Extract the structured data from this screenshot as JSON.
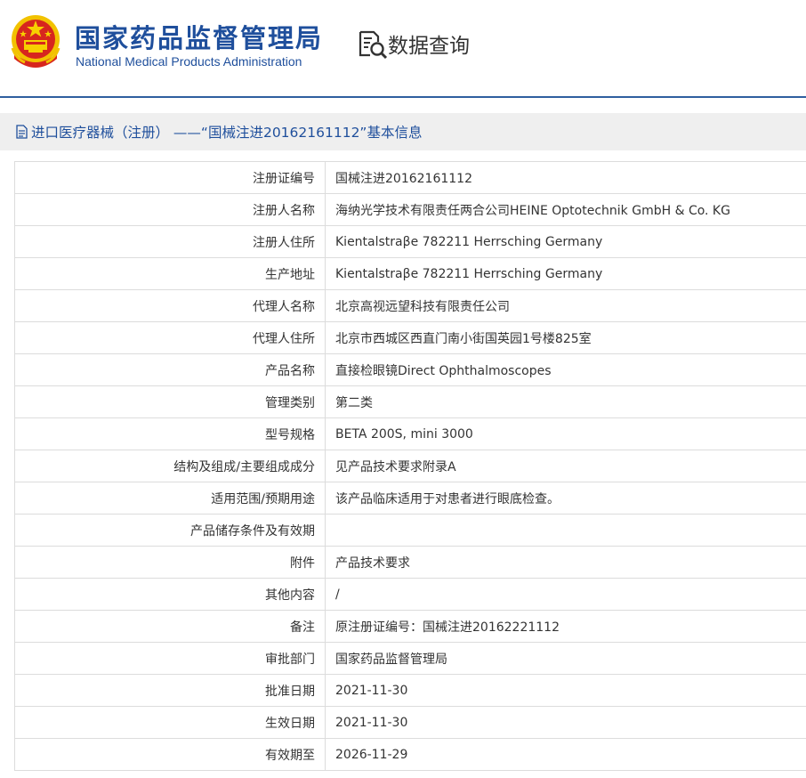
{
  "header": {
    "org_name_cn": "国家药品监督管理局",
    "org_name_en": "National Medical Products Administration",
    "query_label": "数据查询",
    "brand_color": "#1f4f9c"
  },
  "page_title": "进口医疗器械（注册） ——“国械注进20162161112”基本信息",
  "rows": [
    {
      "label": "注册证编号",
      "value": "国械注进20162161112"
    },
    {
      "label": "注册人名称",
      "value": "海纳光学技术有限责任两合公司HEINE Optotechnik GmbH & Co. KG"
    },
    {
      "label": "注册人住所",
      "value": "Kientalstraβe 782211 Herrsching Germany"
    },
    {
      "label": "生产地址",
      "value": "Kientalstraβe 782211 Herrsching Germany"
    },
    {
      "label": "代理人名称",
      "value": "北京高视远望科技有限责任公司"
    },
    {
      "label": "代理人住所",
      "value": "北京市西城区西直门南小街国英园1号楼825室"
    },
    {
      "label": "产品名称",
      "value": "直接检眼镜Direct Ophthalmoscopes"
    },
    {
      "label": "管理类别",
      "value": "第二类"
    },
    {
      "label": "型号规格",
      "value": "BETA 200S, mini 3000"
    },
    {
      "label": "结构及组成/主要组成成分",
      "value": "见产品技术要求附录A"
    },
    {
      "label": "适用范围/预期用途",
      "value": "该产品临床适用于对患者进行眼底检查。"
    },
    {
      "label": "产品储存条件及有效期",
      "value": ""
    },
    {
      "label": "附件",
      "value": "产品技术要求"
    },
    {
      "label": "其他内容",
      "value": "/"
    },
    {
      "label": "备注",
      "value": "原注册证编号：国械注进20162221112"
    },
    {
      "label": "审批部门",
      "value": "国家药品监督管理局"
    },
    {
      "label": "批准日期",
      "value": "2021-11-30"
    },
    {
      "label": "生效日期",
      "value": "2021-11-30"
    },
    {
      "label": "有效期至",
      "value": "2026-11-29"
    }
  ]
}
